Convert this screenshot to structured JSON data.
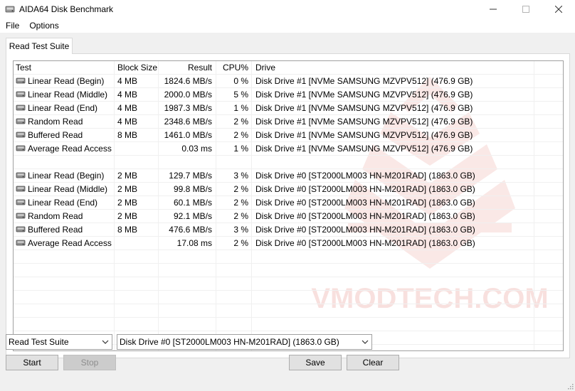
{
  "window": {
    "title": "AIDA64 Disk Benchmark",
    "minimize": "—",
    "maximize": "☐",
    "close": "✕"
  },
  "menu": {
    "items": [
      "File",
      "Options"
    ]
  },
  "tab": {
    "label": "Read Test Suite"
  },
  "table": {
    "headers": {
      "test": "Test",
      "block": "Block Size",
      "result": "Result",
      "cpu": "CPU%",
      "drive": "Drive"
    },
    "rows": [
      {
        "test": "Linear Read (Begin)",
        "block": "4 MB",
        "result": "1824.6 MB/s",
        "cpu": "0 %",
        "drive": "Disk Drive #1  [NVMe    SAMSUNG MZVPV512]  (476.9 GB)"
      },
      {
        "test": "Linear Read (Middle)",
        "block": "4 MB",
        "result": "2000.0 MB/s",
        "cpu": "5 %",
        "drive": "Disk Drive #1  [NVMe    SAMSUNG MZVPV512]  (476.9 GB)"
      },
      {
        "test": "Linear Read (End)",
        "block": "4 MB",
        "result": "1987.3 MB/s",
        "cpu": "1 %",
        "drive": "Disk Drive #1  [NVMe    SAMSUNG MZVPV512]  (476.9 GB)"
      },
      {
        "test": "Random Read",
        "block": "4 MB",
        "result": "2348.6 MB/s",
        "cpu": "2 %",
        "drive": "Disk Drive #1  [NVMe    SAMSUNG MZVPV512]  (476.9 GB)"
      },
      {
        "test": "Buffered Read",
        "block": "8 MB",
        "result": "1461.0 MB/s",
        "cpu": "2 %",
        "drive": "Disk Drive #1  [NVMe    SAMSUNG MZVPV512]  (476.9 GB)"
      },
      {
        "test": "Average Read Access",
        "block": "",
        "result": "0.03 ms",
        "cpu": "1 %",
        "drive": "Disk Drive #1  [NVMe    SAMSUNG MZVPV512]  (476.9 GB)"
      },
      {
        "test": "",
        "block": "",
        "result": "",
        "cpu": "",
        "drive": ""
      },
      {
        "test": "Linear Read (Begin)",
        "block": "2 MB",
        "result": "129.7 MB/s",
        "cpu": "3 %",
        "drive": "Disk Drive #0  [ST2000LM003 HN-M201RAD]  (1863.0 GB)"
      },
      {
        "test": "Linear Read (Middle)",
        "block": "2 MB",
        "result": "99.8 MB/s",
        "cpu": "2 %",
        "drive": "Disk Drive #0  [ST2000LM003 HN-M201RAD]  (1863.0 GB)"
      },
      {
        "test": "Linear Read (End)",
        "block": "2 MB",
        "result": "60.1 MB/s",
        "cpu": "2 %",
        "drive": "Disk Drive #0  [ST2000LM003 HN-M201RAD]  (1863.0 GB)"
      },
      {
        "test": "Random Read",
        "block": "2 MB",
        "result": "92.1 MB/s",
        "cpu": "2 %",
        "drive": "Disk Drive #0  [ST2000LM003 HN-M201RAD]  (1863.0 GB)"
      },
      {
        "test": "Buffered Read",
        "block": "8 MB",
        "result": "476.6 MB/s",
        "cpu": "3 %",
        "drive": "Disk Drive #0  [ST2000LM003 HN-M201RAD]  (1863.0 GB)"
      },
      {
        "test": "Average Read Access",
        "block": "",
        "result": "17.08 ms",
        "cpu": "2 %",
        "drive": "Disk Drive #0  [ST2000LM003 HN-M201RAD]  (1863.0 GB)"
      }
    ]
  },
  "watermark": {
    "text": "VMODTECH.COM"
  },
  "controls": {
    "suite_select": "Read Test Suite",
    "drive_select": "Disk Drive #0  [ST2000LM003 HN-M201RAD]  (1863.0 GB)",
    "start": "Start",
    "stop": "Stop",
    "save": "Save",
    "clear": "Clear"
  },
  "colors": {
    "watermark": "#d9483b",
    "disabled_button": "#cccccc"
  },
  "icons": {
    "app": "disk-icon",
    "row": "disk-drive-icon"
  }
}
